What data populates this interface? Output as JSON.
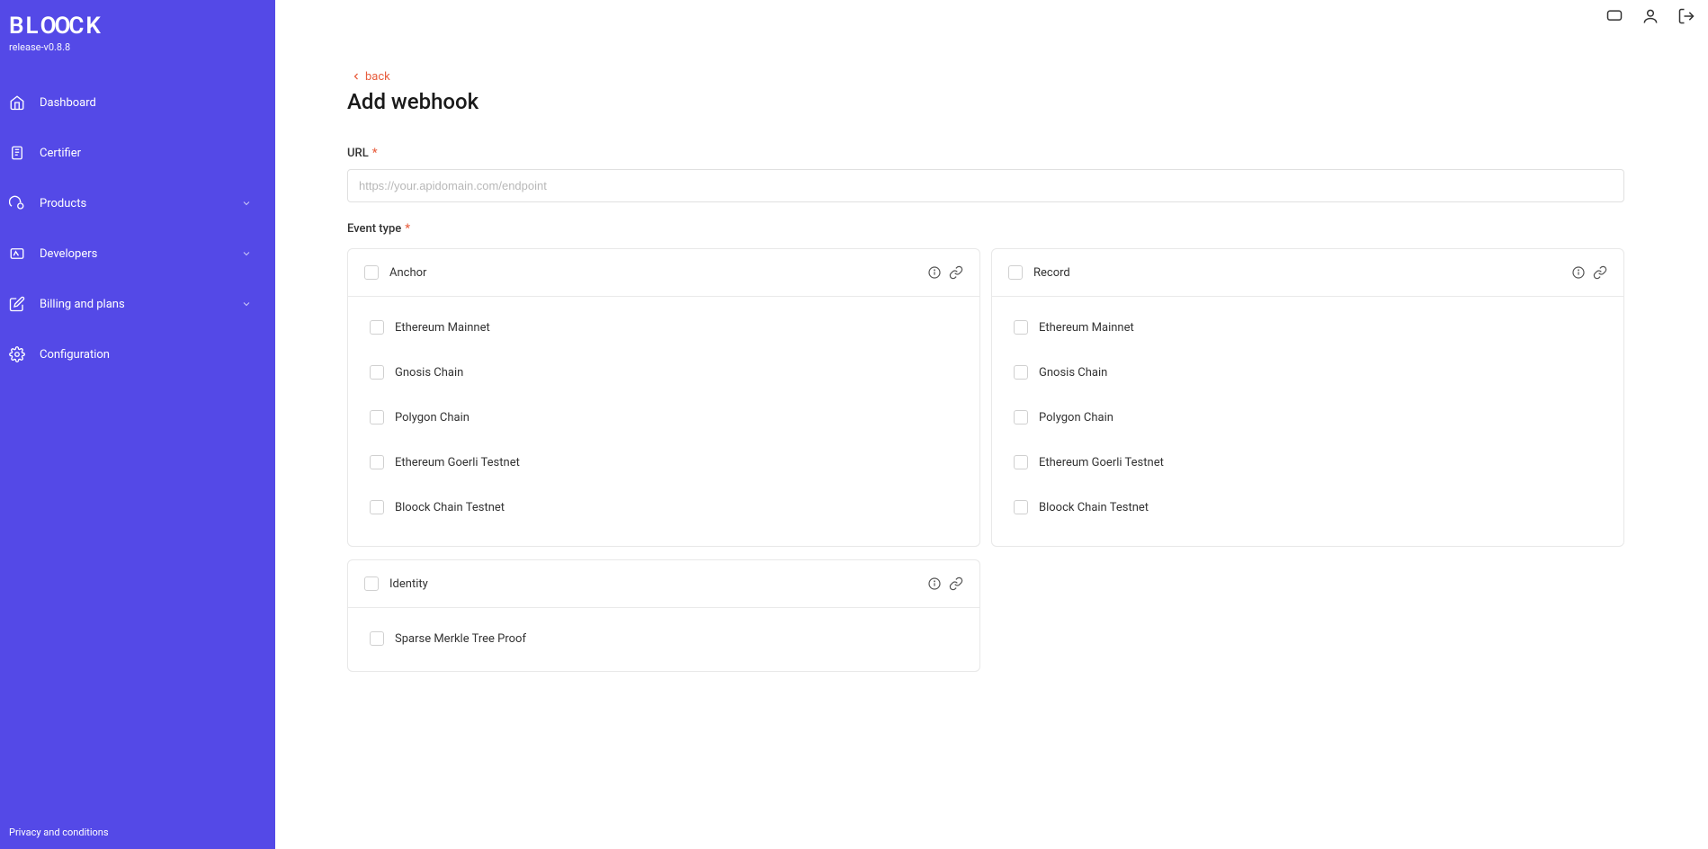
{
  "brand": {
    "logo": "BLOOCK",
    "release": "release-v0.8.8"
  },
  "sidebar": {
    "items": [
      {
        "label": "Dashboard",
        "icon": "home",
        "expandable": false
      },
      {
        "label": "Certifier",
        "icon": "clipboard",
        "expandable": false
      },
      {
        "label": "Products",
        "icon": "cloud",
        "expandable": true
      },
      {
        "label": "Developers",
        "icon": "gauge",
        "expandable": true
      },
      {
        "label": "Billing and plans",
        "icon": "edit",
        "expandable": true
      },
      {
        "label": "Configuration",
        "icon": "gear",
        "expandable": false
      }
    ],
    "footer": "Privacy and conditions"
  },
  "topbar": {
    "icons": [
      "chat",
      "user",
      "logout"
    ]
  },
  "page": {
    "back": "back",
    "title": "Add webhook",
    "url_label": "URL",
    "url_placeholder": "https://your.apidomain.com/endpoint",
    "event_type_label": "Event type",
    "groups": [
      {
        "title": "Anchor",
        "options": [
          "Ethereum Mainnet",
          "Gnosis Chain",
          "Polygon Chain",
          "Ethereum Goerli Testnet",
          "Bloock Chain Testnet"
        ]
      },
      {
        "title": "Record",
        "options": [
          "Ethereum Mainnet",
          "Gnosis Chain",
          "Polygon Chain",
          "Ethereum Goerli Testnet",
          "Bloock Chain Testnet"
        ]
      },
      {
        "title": "Identity",
        "options": [
          "Sparse Merkle Tree Proof"
        ]
      }
    ]
  }
}
